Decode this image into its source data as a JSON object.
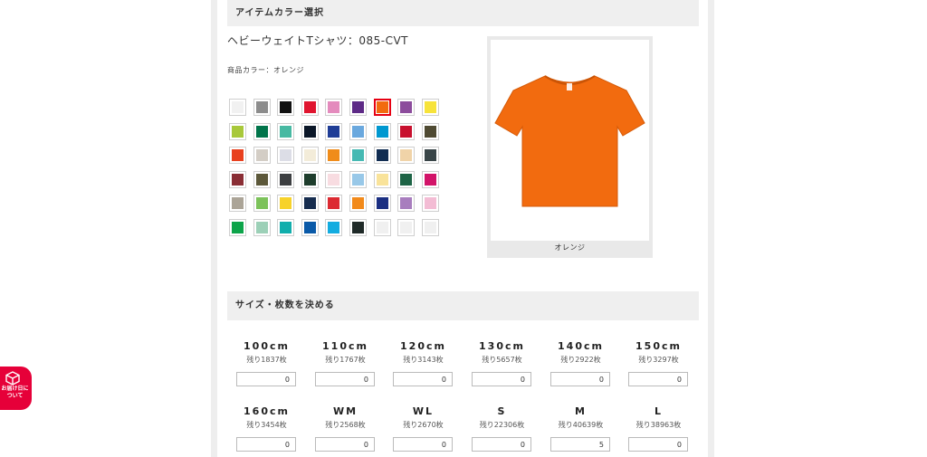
{
  "color_section": {
    "header": "アイテムカラー選択",
    "product_title": "ヘビーウェイトTシャツ：085-CVT",
    "color_label": "商品カラー：オレンジ",
    "selected_color_name": "オレンジ",
    "selected_color_hex": "#f26b0f",
    "swatches": [
      "#f1f1f1",
      "#8c8c8c",
      "#111111",
      "#e0152f",
      "#e48bbd",
      "#5d2a86",
      "#f26b0f",
      "#8c4c9c",
      "#f7e33a",
      "#a8c83a",
      "#00744a",
      "#47b9a2",
      "#0b1728",
      "#1f3d96",
      "#6aa8de",
      "#0098d0",
      "#c8102e",
      "#4f4a32",
      "#e8401e",
      "#d3cdc5",
      "#dcdde6",
      "#f3ecd9",
      "#f08c1a",
      "#46b9b3",
      "#112d52",
      "#f0d3a8",
      "#394548",
      "#8a2e35",
      "#5c583a",
      "#3d3f41",
      "#1e3d2c",
      "#f8dce1",
      "#98c8e8",
      "#f9e39a",
      "#1e6446",
      "#d21469",
      "#aba497",
      "#7cc25a",
      "#f7d22a",
      "#172d4f",
      "#dc2a32",
      "#f28a1b",
      "#1b2f82",
      "#a87dbe",
      "#f3bcd4",
      "#0da44a",
      "#9cd0b7",
      "#11aeac",
      "#0a5aa8",
      "#13ace0",
      "#1f2a28",
      "#f0f0f0",
      "#f0f0f0",
      "#f0f0f0"
    ]
  },
  "size_section": {
    "header": "サイズ・枚数を決める",
    "sizes": [
      {
        "name": "100cm",
        "stock": "残り1837枚",
        "qty": "0"
      },
      {
        "name": "110cm",
        "stock": "残り1767枚",
        "qty": "0"
      },
      {
        "name": "120cm",
        "stock": "残り3143枚",
        "qty": "0"
      },
      {
        "name": "130cm",
        "stock": "残り5657枚",
        "qty": "0"
      },
      {
        "name": "140cm",
        "stock": "残り2922枚",
        "qty": "0"
      },
      {
        "name": "150cm",
        "stock": "残り3297枚",
        "qty": "0"
      },
      {
        "name": "160cm",
        "stock": "残り3454枚",
        "qty": "0"
      },
      {
        "name": "WM",
        "stock": "残り2568枚",
        "qty": "0"
      },
      {
        "name": "WL",
        "stock": "残り2670枚",
        "qty": "0"
      },
      {
        "name": "S",
        "stock": "残り22306枚",
        "qty": "0"
      },
      {
        "name": "M",
        "stock": "残り40639枚",
        "qty": "5"
      },
      {
        "name": "L",
        "stock": "残り38963枚",
        "qty": "0"
      }
    ]
  },
  "delivery_badge": {
    "line1": "お届け日に",
    "line2": "ついて",
    "icon": "package-icon"
  }
}
